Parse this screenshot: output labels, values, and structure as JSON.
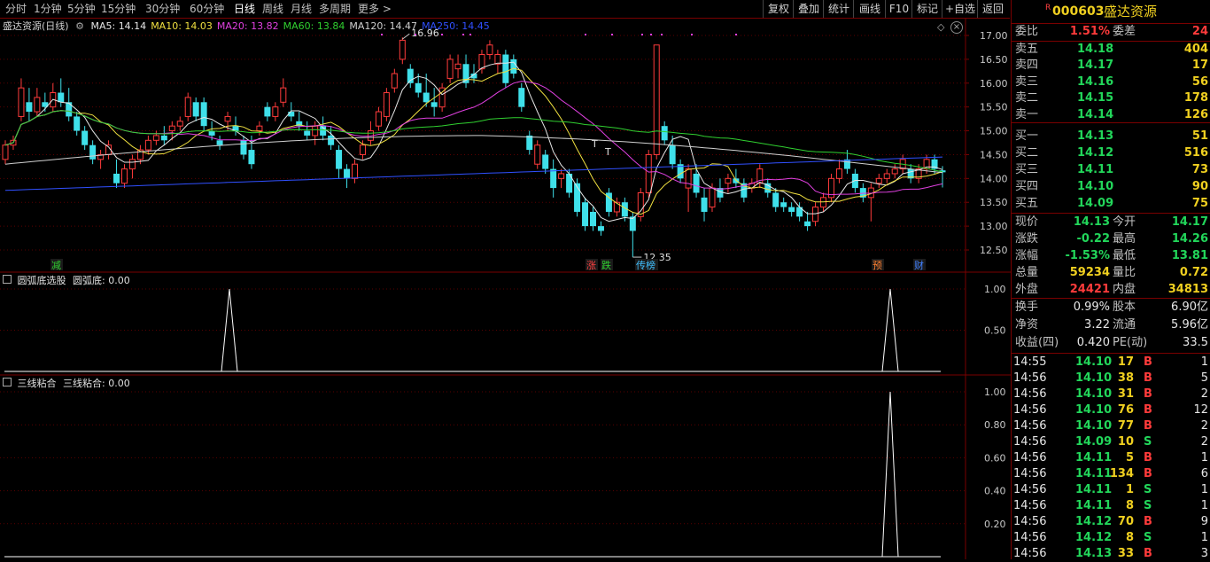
{
  "toolbar": {
    "periods": [
      "分时",
      "1分钟",
      "5分钟",
      "15分钟",
      "30分钟",
      "60分钟",
      "日线",
      "周线",
      "月线",
      "多周期",
      "更多 >"
    ],
    "active_period": "日线",
    "buttons": [
      "复权",
      "叠加",
      "统计",
      "画线",
      "F10",
      "标记",
      "+自选",
      "返回"
    ]
  },
  "main_chart": {
    "stock_label": "盛达资源(日线)",
    "ma": [
      {
        "name": "MA5",
        "value": "14.14",
        "color": "#e6e6e6"
      },
      {
        "name": "MA10",
        "value": "14.03",
        "color": "#f0e040"
      },
      {
        "name": "MA20",
        "value": "13.82",
        "color": "#e040e0"
      },
      {
        "name": "MA60",
        "value": "13.84",
        "color": "#30d030"
      },
      {
        "name": "MA120",
        "value": "14.47",
        "color": "#d0d0d0"
      },
      {
        "name": "MA250",
        "value": "14.45",
        "color": "#3050ff"
      }
    ],
    "high_label": "16.96",
    "low_label": "12.35",
    "y_ticks": [
      "17.00",
      "16.50",
      "16.00",
      "15.50",
      "15.00",
      "14.50",
      "14.00",
      "13.50",
      "13.00",
      "12.50"
    ],
    "markers": [
      {
        "text": "减",
        "color": "#30d030"
      },
      {
        "text": "涨",
        "color": "#ff4040"
      },
      {
        "text": "跌",
        "color": "#30d030"
      },
      {
        "text": "传榜",
        "color": "#40c0ff"
      },
      {
        "text": "预",
        "color": "#ff8030"
      },
      {
        "text": "财",
        "color": "#4080ff"
      }
    ],
    "t_labels": [
      "T",
      "T"
    ]
  },
  "indicator1": {
    "name": "圆弧底选股",
    "line_label": "圆弧底: 0.00",
    "y_ticks": [
      "1.00",
      "0.50"
    ]
  },
  "indicator2": {
    "name": "三线粘合",
    "line_label": "三线粘合: 0.00",
    "y_ticks": [
      "1.00",
      "0.80",
      "0.60",
      "0.40",
      "0.20"
    ]
  },
  "panel": {
    "badge": "R",
    "code": "000603",
    "name": "盛达资源",
    "weibi": {
      "label": "委比",
      "value": "1.51%"
    },
    "weicha": {
      "label": "委差",
      "value": "24"
    },
    "asks": [
      {
        "label": "卖五",
        "price": "14.18",
        "vol": "404"
      },
      {
        "label": "卖四",
        "price": "14.17",
        "vol": "17"
      },
      {
        "label": "卖三",
        "price": "14.16",
        "vol": "56"
      },
      {
        "label": "卖二",
        "price": "14.15",
        "vol": "178"
      },
      {
        "label": "卖一",
        "price": "14.14",
        "vol": "126"
      }
    ],
    "bids": [
      {
        "label": "买一",
        "price": "14.13",
        "vol": "51"
      },
      {
        "label": "买二",
        "price": "14.12",
        "vol": "516"
      },
      {
        "label": "买三",
        "price": "14.11",
        "vol": "73"
      },
      {
        "label": "买四",
        "price": "14.10",
        "vol": "90"
      },
      {
        "label": "买五",
        "price": "14.09",
        "vol": "75"
      }
    ],
    "quote": [
      {
        "l1": "现价",
        "v1": "14.13",
        "c1": "green",
        "l2": "今开",
        "v2": "14.17",
        "c2": "green"
      },
      {
        "l1": "涨跌",
        "v1": "-0.22",
        "c1": "green",
        "l2": "最高",
        "v2": "14.26",
        "c2": "green"
      },
      {
        "l1": "涨幅",
        "v1": "-1.53%",
        "c1": "green",
        "l2": "最低",
        "v2": "13.81",
        "c2": "green"
      },
      {
        "l1": "总量",
        "v1": "59234",
        "c1": "yellow",
        "l2": "量比",
        "v2": "0.72",
        "c2": "yellow"
      },
      {
        "l1": "外盘",
        "v1": "24421",
        "c1": "red",
        "l2": "内盘",
        "v2": "34813",
        "c2": "yellow"
      }
    ],
    "stats": [
      {
        "l1": "换手",
        "v1": "0.99%",
        "l2": "股本",
        "v2": "6.90亿"
      },
      {
        "l1": "净资",
        "v1": "3.22",
        "l2": "流通",
        "v2": "5.96亿"
      },
      {
        "l1": "收益(四)",
        "v1": "0.420",
        "l2": "PE(动)",
        "v2": "33.5"
      }
    ],
    "ticks": [
      {
        "time": "14:55",
        "price": "14.10",
        "vol": "17",
        "side": "B",
        "n": "1"
      },
      {
        "time": "14:56",
        "price": "14.10",
        "vol": "38",
        "side": "B",
        "n": "5"
      },
      {
        "time": "14:56",
        "price": "14.10",
        "vol": "31",
        "side": "B",
        "n": "2"
      },
      {
        "time": "14:56",
        "price": "14.10",
        "vol": "76",
        "side": "B",
        "n": "12"
      },
      {
        "time": "14:56",
        "price": "14.10",
        "vol": "77",
        "side": "B",
        "n": "2"
      },
      {
        "time": "14:56",
        "price": "14.09",
        "vol": "10",
        "side": "S",
        "n": "2"
      },
      {
        "time": "14:56",
        "price": "14.11",
        "vol": "5",
        "side": "B",
        "n": "1"
      },
      {
        "time": "14:56",
        "price": "14.11",
        "vol": "134",
        "side": "B",
        "n": "6"
      },
      {
        "time": "14:56",
        "price": "14.11",
        "vol": "1",
        "side": "S",
        "n": "1"
      },
      {
        "time": "14:56",
        "price": "14.11",
        "vol": "8",
        "side": "S",
        "n": "1"
      },
      {
        "time": "14:56",
        "price": "14.12",
        "vol": "70",
        "side": "B",
        "n": "9"
      },
      {
        "time": "14:56",
        "price": "14.12",
        "vol": "8",
        "side": "S",
        "n": "1"
      },
      {
        "time": "14:56",
        "price": "14.13",
        "vol": "33",
        "side": "B",
        "n": "3"
      }
    ]
  },
  "chart_data": {
    "type": "candlestick",
    "title": "盛达资源(日线)",
    "y_range": [
      12.3,
      17.2
    ],
    "candles": [
      {
        "o": 14.4,
        "h": 14.8,
        "l": 14.3,
        "c": 14.7
      },
      {
        "o": 14.7,
        "h": 14.9,
        "l": 14.6,
        "c": 14.8
      },
      {
        "o": 15.3,
        "h": 16.1,
        "l": 15.2,
        "c": 15.9
      },
      {
        "o": 15.6,
        "h": 15.9,
        "l": 15.2,
        "c": 15.4
      },
      {
        "o": 15.4,
        "h": 15.9,
        "l": 15.3,
        "c": 15.7
      },
      {
        "o": 15.6,
        "h": 15.8,
        "l": 15.4,
        "c": 15.5
      },
      {
        "o": 15.5,
        "h": 16.0,
        "l": 15.4,
        "c": 15.8
      },
      {
        "o": 15.8,
        "h": 16.1,
        "l": 15.5,
        "c": 15.6
      },
      {
        "o": 15.6,
        "h": 15.9,
        "l": 15.2,
        "c": 15.3
      },
      {
        "o": 15.3,
        "h": 15.4,
        "l": 14.9,
        "c": 15.0
      },
      {
        "o": 15.0,
        "h": 15.1,
        "l": 14.6,
        "c": 14.7
      },
      {
        "o": 14.7,
        "h": 14.8,
        "l": 14.3,
        "c": 14.4
      },
      {
        "o": 14.4,
        "h": 14.6,
        "l": 14.2,
        "c": 14.5
      },
      {
        "o": 14.5,
        "h": 14.8,
        "l": 14.4,
        "c": 14.7
      },
      {
        "o": 14.1,
        "h": 14.4,
        "l": 13.8,
        "c": 13.9
      },
      {
        "o": 13.9,
        "h": 14.3,
        "l": 13.8,
        "c": 14.2
      },
      {
        "o": 14.2,
        "h": 14.5,
        "l": 14.0,
        "c": 14.4
      },
      {
        "o": 14.4,
        "h": 14.7,
        "l": 14.3,
        "c": 14.6
      },
      {
        "o": 14.6,
        "h": 14.9,
        "l": 14.5,
        "c": 14.8
      },
      {
        "o": 14.8,
        "h": 15.0,
        "l": 14.7,
        "c": 14.9
      },
      {
        "o": 14.9,
        "h": 15.1,
        "l": 14.7,
        "c": 14.8
      },
      {
        "o": 15.0,
        "h": 15.2,
        "l": 14.8,
        "c": 15.1
      },
      {
        "o": 15.1,
        "h": 15.3,
        "l": 15.0,
        "c": 15.2
      },
      {
        "o": 15.3,
        "h": 15.8,
        "l": 15.2,
        "c": 15.7
      },
      {
        "o": 15.6,
        "h": 15.7,
        "l": 15.2,
        "c": 15.3
      },
      {
        "o": 15.6,
        "h": 15.7,
        "l": 15.0,
        "c": 15.1
      },
      {
        "o": 15.0,
        "h": 15.2,
        "l": 14.8,
        "c": 14.9
      },
      {
        "o": 14.8,
        "h": 14.9,
        "l": 14.6,
        "c": 14.7
      },
      {
        "o": 15.2,
        "h": 15.4,
        "l": 15.0,
        "c": 15.3
      },
      {
        "o": 15.1,
        "h": 15.3,
        "l": 14.9,
        "c": 15.0
      },
      {
        "o": 14.8,
        "h": 14.9,
        "l": 14.4,
        "c": 14.5
      },
      {
        "o": 14.6,
        "h": 14.9,
        "l": 14.2,
        "c": 14.3
      },
      {
        "o": 15.0,
        "h": 15.2,
        "l": 14.9,
        "c": 15.1
      },
      {
        "o": 15.5,
        "h": 15.6,
        "l": 15.2,
        "c": 15.3
      },
      {
        "o": 15.3,
        "h": 15.6,
        "l": 15.2,
        "c": 15.5
      },
      {
        "o": 15.6,
        "h": 16.1,
        "l": 15.5,
        "c": 15.9
      },
      {
        "o": 15.4,
        "h": 15.6,
        "l": 15.2,
        "c": 15.3
      },
      {
        "o": 15.2,
        "h": 15.4,
        "l": 15.0,
        "c": 15.1
      },
      {
        "o": 15.0,
        "h": 15.2,
        "l": 14.8,
        "c": 14.9
      },
      {
        "o": 14.9,
        "h": 15.2,
        "l": 14.7,
        "c": 15.1
      },
      {
        "o": 15.1,
        "h": 15.3,
        "l": 14.8,
        "c": 14.9
      },
      {
        "o": 14.9,
        "h": 15.1,
        "l": 14.6,
        "c": 14.7
      },
      {
        "o": 14.6,
        "h": 14.7,
        "l": 14.0,
        "c": 14.2
      },
      {
        "o": 14.2,
        "h": 14.3,
        "l": 13.8,
        "c": 14.0
      },
      {
        "o": 14.0,
        "h": 14.4,
        "l": 13.9,
        "c": 14.3
      },
      {
        "o": 14.5,
        "h": 14.8,
        "l": 14.4,
        "c": 14.7
      },
      {
        "o": 14.8,
        "h": 15.2,
        "l": 14.7,
        "c": 15.0
      },
      {
        "o": 15.1,
        "h": 15.5,
        "l": 15.0,
        "c": 15.4
      },
      {
        "o": 15.3,
        "h": 15.9,
        "l": 15.2,
        "c": 15.8
      },
      {
        "o": 15.9,
        "h": 16.3,
        "l": 15.8,
        "c": 16.2
      },
      {
        "o": 16.5,
        "h": 16.96,
        "l": 16.4,
        "c": 16.9
      },
      {
        "o": 16.3,
        "h": 16.4,
        "l": 15.9,
        "c": 16.0
      },
      {
        "o": 16.0,
        "h": 16.2,
        "l": 15.7,
        "c": 15.8
      },
      {
        "o": 15.8,
        "h": 16.2,
        "l": 15.5,
        "c": 15.6
      },
      {
        "o": 15.6,
        "h": 15.9,
        "l": 15.3,
        "c": 15.5
      },
      {
        "o": 15.5,
        "h": 16.0,
        "l": 15.4,
        "c": 15.9
      },
      {
        "o": 16.1,
        "h": 16.6,
        "l": 16.0,
        "c": 16.5
      },
      {
        "o": 16.3,
        "h": 16.6,
        "l": 16.1,
        "c": 16.4
      },
      {
        "o": 16.4,
        "h": 16.6,
        "l": 15.9,
        "c": 16.0
      },
      {
        "o": 16.2,
        "h": 16.4,
        "l": 16.0,
        "c": 16.1
      },
      {
        "o": 16.3,
        "h": 16.7,
        "l": 16.2,
        "c": 16.6
      },
      {
        "o": 16.6,
        "h": 16.9,
        "l": 16.5,
        "c": 16.8
      },
      {
        "o": 16.4,
        "h": 16.7,
        "l": 16.2,
        "c": 16.6
      },
      {
        "o": 16.6,
        "h": 16.7,
        "l": 15.9,
        "c": 16.0
      },
      {
        "o": 16.5,
        "h": 16.6,
        "l": 16.1,
        "c": 16.2
      },
      {
        "o": 15.9,
        "h": 16.0,
        "l": 15.4,
        "c": 15.5
      },
      {
        "o": 14.9,
        "h": 15.0,
        "l": 14.5,
        "c": 14.6
      },
      {
        "o": 14.3,
        "h": 14.8,
        "l": 14.2,
        "c": 14.7
      },
      {
        "o": 14.5,
        "h": 14.6,
        "l": 14.1,
        "c": 14.2
      },
      {
        "o": 14.2,
        "h": 14.4,
        "l": 13.6,
        "c": 13.8
      },
      {
        "o": 14.0,
        "h": 14.2,
        "l": 13.8,
        "c": 14.1
      },
      {
        "o": 14.1,
        "h": 14.2,
        "l": 13.6,
        "c": 13.7
      },
      {
        "o": 13.9,
        "h": 14.0,
        "l": 13.2,
        "c": 13.3
      },
      {
        "o": 13.5,
        "h": 13.6,
        "l": 12.9,
        "c": 13.0
      },
      {
        "o": 13.3,
        "h": 13.4,
        "l": 12.9,
        "c": 13.0
      },
      {
        "o": 13.0,
        "h": 13.1,
        "l": 12.8,
        "c": 12.9
      },
      {
        "o": 13.7,
        "h": 13.8,
        "l": 13.2,
        "c": 13.3
      },
      {
        "o": 13.3,
        "h": 13.6,
        "l": 13.2,
        "c": 13.5
      },
      {
        "o": 13.5,
        "h": 13.6,
        "l": 13.1,
        "c": 13.2
      },
      {
        "o": 13.2,
        "h": 13.3,
        "l": 12.35,
        "c": 12.9
      },
      {
        "o": 13.2,
        "h": 13.8,
        "l": 13.1,
        "c": 13.7
      },
      {
        "o": 13.7,
        "h": 14.6,
        "l": 13.6,
        "c": 14.5
      },
      {
        "o": 14.5,
        "h": 16.8,
        "l": 14.4,
        "c": 16.8
      },
      {
        "o": 15.1,
        "h": 15.2,
        "l": 14.7,
        "c": 14.8
      },
      {
        "o": 14.7,
        "h": 14.9,
        "l": 14.2,
        "c": 14.3
      },
      {
        "o": 14.3,
        "h": 14.4,
        "l": 13.9,
        "c": 14.0
      },
      {
        "o": 13.8,
        "h": 14.3,
        "l": 13.3,
        "c": 14.2
      },
      {
        "o": 14.1,
        "h": 14.3,
        "l": 13.6,
        "c": 13.7
      },
      {
        "o": 13.6,
        "h": 13.8,
        "l": 13.1,
        "c": 13.3
      },
      {
        "o": 13.4,
        "h": 13.9,
        "l": 13.3,
        "c": 13.8
      },
      {
        "o": 13.8,
        "h": 14.0,
        "l": 13.5,
        "c": 13.6
      },
      {
        "o": 13.9,
        "h": 14.1,
        "l": 13.7,
        "c": 14.0
      },
      {
        "o": 14.0,
        "h": 14.2,
        "l": 13.8,
        "c": 13.9
      },
      {
        "o": 13.9,
        "h": 14.0,
        "l": 13.5,
        "c": 13.6
      },
      {
        "o": 13.8,
        "h": 14.0,
        "l": 13.7,
        "c": 13.9
      },
      {
        "o": 13.9,
        "h": 14.3,
        "l": 13.8,
        "c": 14.2
      },
      {
        "o": 13.9,
        "h": 14.0,
        "l": 13.6,
        "c": 13.7
      },
      {
        "o": 13.7,
        "h": 13.8,
        "l": 13.3,
        "c": 13.4
      },
      {
        "o": 13.5,
        "h": 13.6,
        "l": 13.3,
        "c": 13.4
      },
      {
        "o": 13.4,
        "h": 13.5,
        "l": 13.2,
        "c": 13.3
      },
      {
        "o": 13.4,
        "h": 13.5,
        "l": 13.1,
        "c": 13.2
      },
      {
        "o": 13.1,
        "h": 13.3,
        "l": 12.9,
        "c": 13.0
      },
      {
        "o": 13.1,
        "h": 13.5,
        "l": 13.0,
        "c": 13.4
      },
      {
        "o": 13.4,
        "h": 13.7,
        "l": 13.3,
        "c": 13.6
      },
      {
        "o": 13.6,
        "h": 14.1,
        "l": 13.5,
        "c": 14.0
      },
      {
        "o": 14.0,
        "h": 14.4,
        "l": 13.9,
        "c": 14.2
      },
      {
        "o": 14.4,
        "h": 14.6,
        "l": 14.1,
        "c": 14.2
      },
      {
        "o": 14.1,
        "h": 14.2,
        "l": 13.7,
        "c": 13.8
      },
      {
        "o": 13.8,
        "h": 13.9,
        "l": 13.5,
        "c": 13.6
      },
      {
        "o": 13.6,
        "h": 13.9,
        "l": 13.1,
        "c": 13.8
      },
      {
        "o": 13.9,
        "h": 14.1,
        "l": 13.8,
        "c": 14.0
      },
      {
        "o": 14.0,
        "h": 14.2,
        "l": 13.9,
        "c": 14.1
      },
      {
        "o": 14.1,
        "h": 14.3,
        "l": 14.0,
        "c": 14.2
      },
      {
        "o": 14.2,
        "h": 14.5,
        "l": 14.1,
        "c": 14.4
      },
      {
        "o": 14.2,
        "h": 14.3,
        "l": 13.9,
        "c": 14.0
      },
      {
        "o": 14.0,
        "h": 14.3,
        "l": 13.9,
        "c": 14.2
      },
      {
        "o": 14.2,
        "h": 14.5,
        "l": 14.1,
        "c": 14.4
      },
      {
        "o": 14.4,
        "h": 14.5,
        "l": 14.1,
        "c": 14.2
      },
      {
        "o": 14.17,
        "h": 14.26,
        "l": 13.81,
        "c": 14.13
      }
    ],
    "ma_series": [
      {
        "name": "MA5",
        "color": "#e6e6e6"
      },
      {
        "name": "MA10",
        "color": "#f0e040"
      },
      {
        "name": "MA20",
        "color": "#e040e0"
      },
      {
        "name": "MA60",
        "color": "#30d030"
      },
      {
        "name": "MA120",
        "color": "#d0d0d0"
      },
      {
        "name": "MA250",
        "color": "#3050ff"
      }
    ],
    "indicator1_peaks": [
      0.0,
      1.0,
      0.0,
      1.0,
      0.0
    ],
    "indicator2_peaks": [
      0.0,
      1.0,
      0.0
    ]
  }
}
